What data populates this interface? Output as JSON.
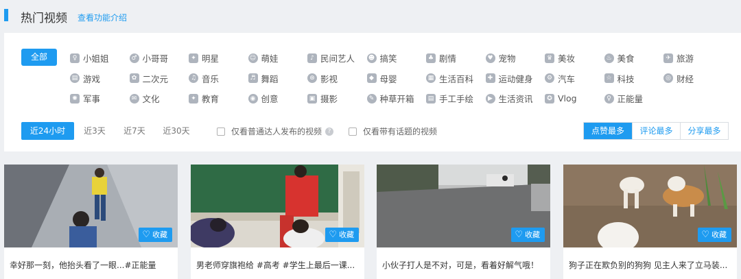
{
  "header": {
    "title": "热门视频",
    "intro_link": "查看功能介绍"
  },
  "categories": {
    "all_label": "全部",
    "rows": [
      [
        {
          "label": "小姐姐",
          "icon": "girl-icon"
        },
        {
          "label": "小哥哥",
          "icon": "boy-icon"
        },
        {
          "label": "明星",
          "icon": "star-icon"
        },
        {
          "label": "萌娃",
          "icon": "baby-icon"
        },
        {
          "label": "民间艺人",
          "icon": "folk-artist-icon"
        },
        {
          "label": "搞笑",
          "icon": "funny-icon"
        },
        {
          "label": "剧情",
          "icon": "drama-icon"
        },
        {
          "label": "宠物",
          "icon": "pet-icon"
        },
        {
          "label": "美妆",
          "icon": "makeup-icon"
        },
        {
          "label": "美食",
          "icon": "food-icon"
        },
        {
          "label": "旅游",
          "icon": "travel-icon"
        }
      ],
      [
        {
          "label": "游戏",
          "icon": "gamepad-icon"
        },
        {
          "label": "二次元",
          "icon": "anime-icon"
        },
        {
          "label": "音乐",
          "icon": "music-icon"
        },
        {
          "label": "舞蹈",
          "icon": "dance-icon"
        },
        {
          "label": "影视",
          "icon": "film-icon"
        },
        {
          "label": "母婴",
          "icon": "mother-baby-icon"
        },
        {
          "label": "生活百科",
          "icon": "encyclopedia-icon"
        },
        {
          "label": "运动健身",
          "icon": "fitness-icon"
        },
        {
          "label": "汽车",
          "icon": "car-icon"
        },
        {
          "label": "科技",
          "icon": "tech-icon"
        },
        {
          "label": "财经",
          "icon": "finance-icon"
        }
      ],
      [
        {
          "label": "军事",
          "icon": "military-icon"
        },
        {
          "label": "文化",
          "icon": "culture-icon"
        },
        {
          "label": "教育",
          "icon": "education-icon"
        },
        {
          "label": "创意",
          "icon": "creative-icon"
        },
        {
          "label": "摄影",
          "icon": "camera-icon"
        },
        {
          "label": "种草开箱",
          "icon": "unboxing-icon"
        },
        {
          "label": "手工手绘",
          "icon": "handcraft-icon"
        },
        {
          "label": "生活资讯",
          "icon": "news-icon"
        },
        {
          "label": "Vlog",
          "icon": "vlog-icon"
        },
        {
          "label": "正能量",
          "icon": "positive-energy-icon"
        }
      ]
    ]
  },
  "filters": {
    "time": [
      "近24小时",
      "近3天",
      "近7天",
      "近30天"
    ],
    "time_active": "近24小时",
    "check_talent": "仅看普通达人发布的视频",
    "check_topic": "仅看带有话题的视频",
    "help_glyph": "?",
    "sort": [
      "点赞最多",
      "评论最多",
      "分享最多"
    ],
    "sort_active": "点赞最多"
  },
  "cards": [
    {
      "caption": "幸好那一刻，他抬头看了一眼...#正能量",
      "fav_label": "收藏"
    },
    {
      "caption": "男老师穿旗袍给 #高考 #学生上最后一课...",
      "fav_label": "收藏"
    },
    {
      "caption": "小伙子打人是不对，可是，看着好解气哦！",
      "fav_label": "收藏"
    },
    {
      "caption": "狗子正在欺负别的狗狗 见主人来了立马装...",
      "fav_label": "收藏"
    }
  ],
  "colors": {
    "accent": "#1e9bf0",
    "icon_gray": "#aeb4bd"
  }
}
